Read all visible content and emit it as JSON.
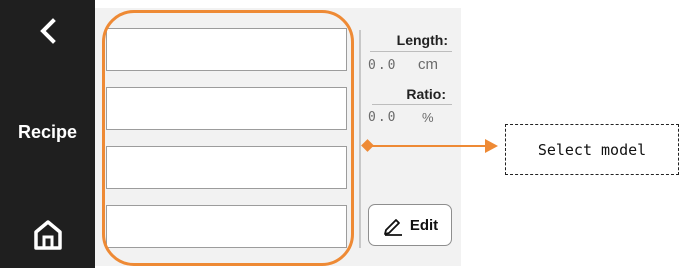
{
  "sidebar": {
    "back_icon": "chevron-left-icon",
    "title": "Recipe",
    "home_icon": "home-icon"
  },
  "model_slots": [
    "",
    "",
    "",
    ""
  ],
  "info": {
    "length_label": "Length:",
    "length_value": "0.0",
    "length_unit": "cm",
    "ratio_label": "Ratio:",
    "ratio_value": "0.0",
    "ratio_unit": "%"
  },
  "edit_button": {
    "label": "Edit",
    "icon": "pencil-icon"
  },
  "annotation": {
    "text": "Select model",
    "color": "#ee8a35"
  },
  "colors": {
    "sidebar_bg": "#1f1f1f",
    "panel_bg": "#f2f2f2",
    "accent": "#ee8a35"
  }
}
